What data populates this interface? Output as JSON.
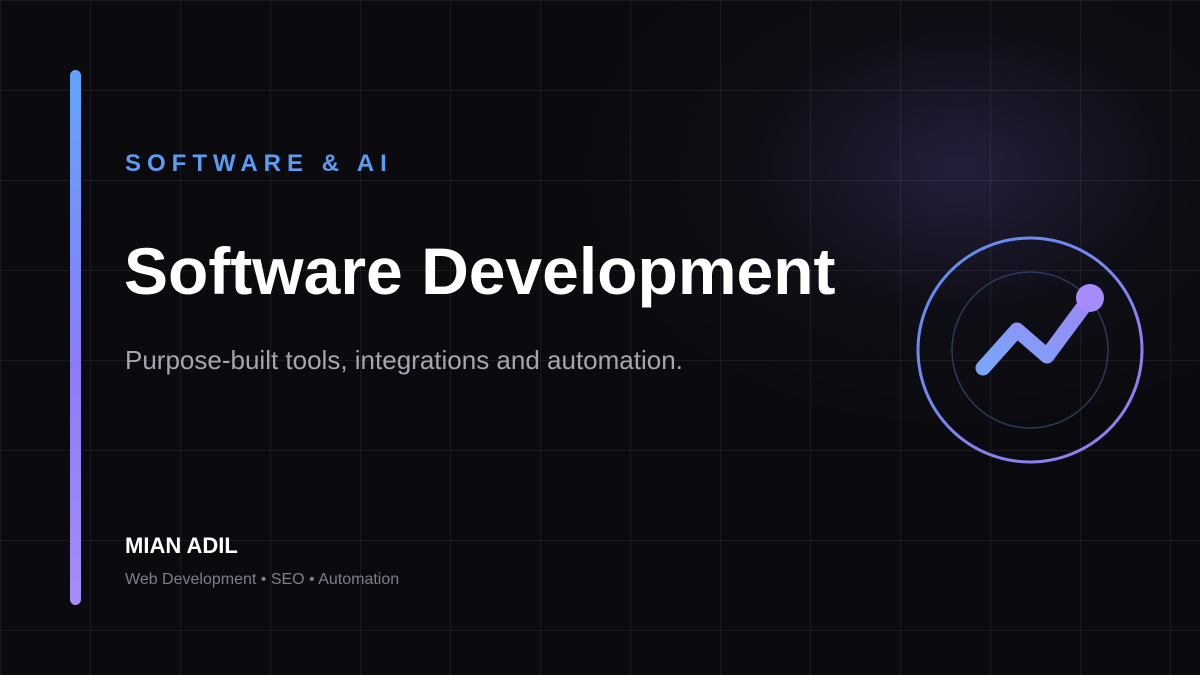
{
  "eyebrow": "SOFTWARE & AI",
  "title": "Software Development",
  "subtitle": "Purpose-built tools, integrations and automation.",
  "author": {
    "name": "MIAN ADIL",
    "tagline": "Web Development • SEO • Automation"
  },
  "emblem": {
    "icon": "trending-up-icon"
  },
  "colors": {
    "background": "#0b0b0f",
    "accent_blue": "#60a5fa",
    "accent_violet": "#a78bfa",
    "eyebrow": "#5b9cf0",
    "subtitle": "#a4a7b0",
    "tagline": "#7c7f88"
  }
}
